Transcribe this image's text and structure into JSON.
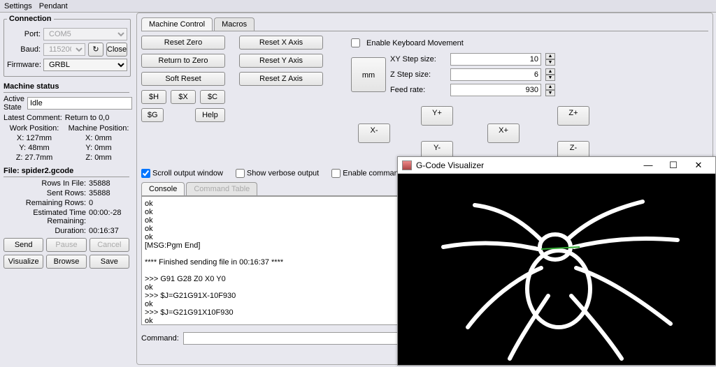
{
  "menu": {
    "settings": "Settings",
    "pendant": "Pendant"
  },
  "connection": {
    "title": "Connection",
    "port_lbl": "Port:",
    "port_val": "COM5",
    "baud_lbl": "Baud:",
    "baud_val": "115200",
    "close_btn": "Close",
    "firmware_lbl": "Firmware:",
    "firmware_val": "GRBL"
  },
  "status": {
    "title": "Machine status",
    "active_state_lbl": "Active State",
    "active_state_val": "Idle",
    "latest_comment_lbl": "Latest Comment:",
    "latest_comment_val": "Return to 0,0",
    "work_pos_hdr": "Work Position:",
    "machine_pos_hdr": "Machine Position:",
    "work": {
      "x": "X: 127mm",
      "y": "Y: 48mm",
      "z": "Z: 27.7mm"
    },
    "machine": {
      "x": "X: 0mm",
      "y": "Y: 0mm",
      "z": "Z: 0mm"
    }
  },
  "file": {
    "title": "File: spider2.gcode",
    "rows_in_file_lbl": "Rows In File:",
    "rows_in_file_val": "35888",
    "sent_rows_lbl": "Sent Rows:",
    "sent_rows_val": "35888",
    "remaining_rows_lbl": "Remaining Rows:",
    "remaining_rows_val": "0",
    "etr_lbl": "Estimated Time Remaining:",
    "etr_val": "00:00:-28",
    "duration_lbl": "Duration:",
    "duration_val": "00:16:37",
    "send": "Send",
    "pause": "Pause",
    "cancel": "Cancel",
    "visualize": "Visualize",
    "browse": "Browse",
    "save": "Save"
  },
  "tabs": {
    "mc": "Machine Control",
    "macros": "Macros"
  },
  "mc": {
    "reset_zero": "Reset Zero",
    "return_to_zero": "Return to Zero",
    "soft_reset": "Soft Reset",
    "sh": "$H",
    "sx": "$X",
    "sc": "$C",
    "sg": "$G",
    "help": "Help",
    "reset_x": "Reset X Axis",
    "reset_y": "Reset Y Axis",
    "reset_z": "Reset Z Axis"
  },
  "kbd": {
    "enable": "Enable Keyboard Movement",
    "mm": "mm",
    "xy_lbl": "XY Step size:",
    "xy_val": "10",
    "z_lbl": "Z Step size:",
    "z_val": "6",
    "feed_lbl": "Feed rate:",
    "feed_val": "930",
    "yplus": "Y+",
    "yminus": "Y-",
    "xplus": "X+",
    "xminus": "X-",
    "zplus": "Z+",
    "zminus": "Z-"
  },
  "checks": {
    "scroll": "Scroll output window",
    "verbose": "Show verbose output",
    "cmdtable": "Enable command table"
  },
  "console_tabs": {
    "console": "Console",
    "cmdtable": "Command Table"
  },
  "console_text": "ok\nok\nok\nok\nok\n[MSG:Pgm End]\n\n**** Finished sending file in 00:16:37 ****\n\n>>> G91 G28 Z0 X0 Y0\nok\n>>> $J=G21G91X-10F930\nok\n>>> $J=G21G91X10F930\nok",
  "command_lbl": "Command:",
  "vis": {
    "title": "G-Code Visualizer",
    "min": "—",
    "max": "☐",
    "close": "✕"
  }
}
